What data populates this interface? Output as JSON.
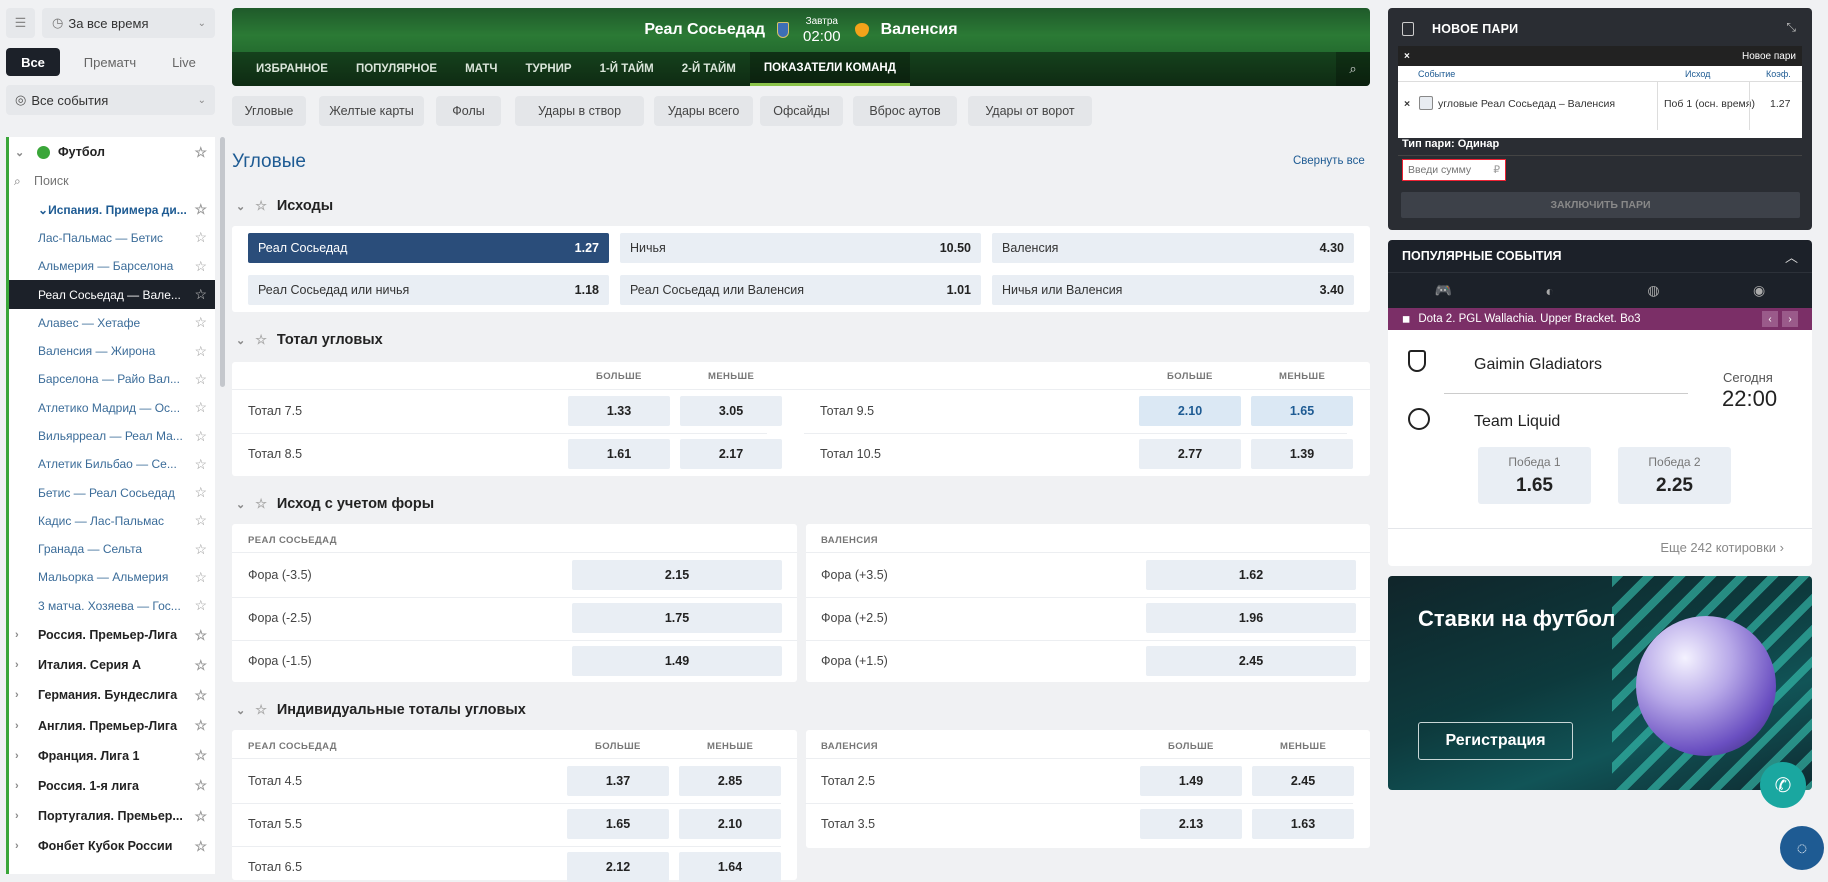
{
  "left": {
    "period": "За все время",
    "tabs": [
      "Все",
      "Прематч",
      "Live"
    ],
    "events_filter": "Все события",
    "sport": "Футбол",
    "search_placeholder": "Поиск",
    "items": [
      {
        "label": "Испания. Примера ди...",
        "kind": "blue"
      },
      {
        "label": "Лас-Пальмас — Бетис",
        "kind": "match"
      },
      {
        "label": "Альмерия — Барселона",
        "kind": "match"
      },
      {
        "label": "Реал Сосьедад — Вале...",
        "kind": "active"
      },
      {
        "label": "Алавес — Хетафе",
        "kind": "match"
      },
      {
        "label": "Валенсия — Жирона",
        "kind": "match"
      },
      {
        "label": "Барселона — Райо Вал...",
        "kind": "match"
      },
      {
        "label": "Атлетико Мадрид — Ос...",
        "kind": "match"
      },
      {
        "label": "Вильярреал — Реал Ма...",
        "kind": "match"
      },
      {
        "label": "Атлетик Бильбао — Се...",
        "kind": "match"
      },
      {
        "label": "Бетис — Реал Сосьедад",
        "kind": "match"
      },
      {
        "label": "Кадис — Лас-Пальмас",
        "kind": "match"
      },
      {
        "label": "Гранада — Сельта",
        "kind": "match"
      },
      {
        "label": "Мальорка — Альмерия",
        "kind": "match"
      },
      {
        "label": "3 матча. Хозяева — Гос...",
        "kind": "match"
      },
      {
        "label": "Россия. Премьер-Лига",
        "kind": "league"
      },
      {
        "label": "Италия. Серия А",
        "kind": "league"
      },
      {
        "label": "Германия. Бундеслига",
        "kind": "league"
      },
      {
        "label": "Англия. Премьер-Лига",
        "kind": "league"
      },
      {
        "label": "Франция. Лига 1",
        "kind": "league"
      },
      {
        "label": "Россия. 1-я лига",
        "kind": "league"
      },
      {
        "label": "Португалия. Премьер...",
        "kind": "league"
      },
      {
        "label": "Фонбет Кубок России",
        "kind": "league"
      }
    ]
  },
  "match": {
    "home": "Реал Сосьедад",
    "away": "Валенсия",
    "day": "Завтра",
    "time": "02:00",
    "nav": [
      "ИЗБРАННОЕ",
      "ПОПУЛЯРНОЕ",
      "МАТЧ",
      "ТУРНИР",
      "1-Й ТАЙМ",
      "2-Й ТАЙМ",
      "ПОКАЗАТЕЛИ КОМАНД"
    ]
  },
  "chips": [
    "Угловые",
    "Желтые карты",
    "Фолы",
    "Удары в створ",
    "Удары всего",
    "Офсайды",
    "Вброс аутов",
    "Удары от ворот"
  ],
  "page_title": "Угловые",
  "collapse_all": "Свернуть все",
  "outcomes": {
    "title": "Исходы",
    "rows": [
      [
        {
          "l": "Реал Сосьедад",
          "v": "1.27",
          "sel": true
        },
        {
          "l": "Ничья",
          "v": "10.50"
        },
        {
          "l": "Валенсия",
          "v": "4.30"
        }
      ],
      [
        {
          "l": "Реал Сосьедад или ничья",
          "v": "1.18"
        },
        {
          "l": "Реал Сосьедад или Валенсия",
          "v": "1.01"
        },
        {
          "l": "Ничья или Валенсия",
          "v": "3.40"
        }
      ]
    ]
  },
  "totals": {
    "title": "Тотал угловых",
    "more": "БОЛЬШЕ",
    "less": "МЕНЬШЕ",
    "left": [
      {
        "l": "Тотал 7.5",
        "o": "1.33",
        "u": "3.05"
      },
      {
        "l": "Тотал 8.5",
        "o": "1.61",
        "u": "2.17"
      }
    ],
    "right": [
      {
        "l": "Тотал 9.5",
        "o": "2.10",
        "u": "1.65"
      },
      {
        "l": "Тотал 10.5",
        "o": "2.77",
        "u": "1.39"
      }
    ]
  },
  "handicap": {
    "title": "Исход с учетом форы",
    "home": "РЕАЛ СОСЬЕДАД",
    "away": "ВАЛЕНСИЯ",
    "left": [
      {
        "l": "Фора (-3.5)",
        "v": "2.15"
      },
      {
        "l": "Фора (-2.5)",
        "v": "1.75"
      },
      {
        "l": "Фора (-1.5)",
        "v": "1.49"
      }
    ],
    "right": [
      {
        "l": "Фора (+3.5)",
        "v": "1.62"
      },
      {
        "l": "Фора (+2.5)",
        "v": "1.96"
      },
      {
        "l": "Фора (+1.5)",
        "v": "2.45"
      }
    ]
  },
  "indiv": {
    "title": "Индивидуальные тоталы угловых",
    "home": "РЕАЛ СОСЬЕДАД",
    "away": "ВАЛЕНСИЯ",
    "more": "БОЛЬШЕ",
    "less": "МЕНЬШЕ",
    "left": [
      {
        "l": "Тотал 4.5",
        "o": "1.37",
        "u": "2.85"
      },
      {
        "l": "Тотал 5.5",
        "o": "1.65",
        "u": "2.10"
      },
      {
        "l": "Тотал 6.5",
        "o": "2.12",
        "u": "1.64"
      }
    ],
    "right": [
      {
        "l": "Тотал 2.5",
        "o": "1.49",
        "u": "2.45"
      },
      {
        "l": "Тотал 3.5",
        "o": "2.13",
        "u": "1.63"
      }
    ]
  },
  "betslip": {
    "title": "НОВОЕ ПАРИ",
    "new_bet": "Новое пари",
    "col_event": "Событие",
    "col_outcome": "Исход",
    "col_coef": "Коэф.",
    "event": "угловые Реал Сосьедад – Валенсия",
    "outcome": "Поб 1 (осн. время)",
    "coef": "1.27",
    "bet_type_label": "Тип пари: Одинар",
    "amount_placeholder": "Введи сумму",
    "currency": "₽",
    "submit": "ЗАКЛЮЧИТЬ ПАРИ"
  },
  "popular": {
    "title": "ПОПУЛЯРНЫЕ СОБЫТИЯ",
    "event": "Dota 2. PGL Wallachia. Upper Bracket. Bo3",
    "team1": "Gaimin Gladiators",
    "team2": "Team Liquid",
    "day": "Сегодня",
    "time": "22:00",
    "w1_label": "Победа 1",
    "w1": "1.65",
    "w2_label": "Победа 2",
    "w2": "2.25",
    "more": "Еще 242 котировки"
  },
  "promo": {
    "title": "Ставки на футбол",
    "button": "Регистрация"
  },
  "colors": {
    "accent": "#1e5b93",
    "selected": "#2a4d7a",
    "green": "#3aa639",
    "dark": "#1c2129"
  }
}
